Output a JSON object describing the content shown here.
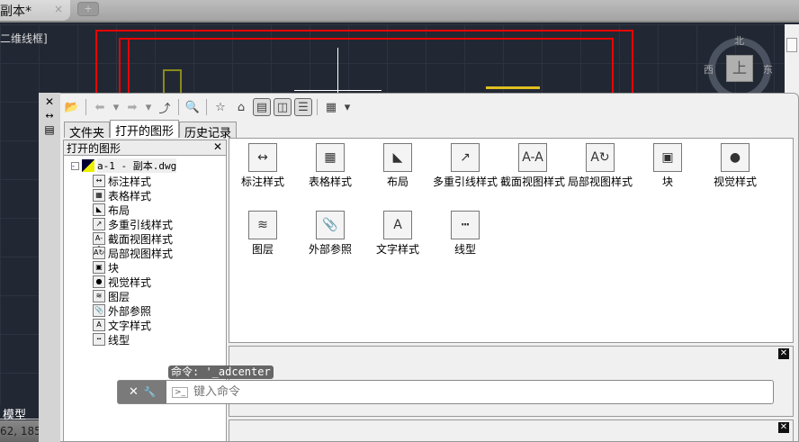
{
  "tabbar": {
    "doc_tab": "副本*",
    "close": "×",
    "new_tab": "+"
  },
  "viewport": {
    "view_label": "二维线框]",
    "compass": {
      "north": "北",
      "west": "西",
      "east": "东",
      "cube": "上"
    }
  },
  "palette": {
    "side": {
      "close": "✕",
      "autohide": "↔",
      "props": "▤"
    },
    "tabs": [
      "文件夹",
      "打开的图形",
      "历史记录"
    ],
    "tree": {
      "header": "打开的图形",
      "close": "✕",
      "root": "a-1 - 副本.dwg",
      "items": [
        "标注样式",
        "表格样式",
        "布局",
        "多重引线样式",
        "截面视图样式",
        "局部视图样式",
        "块",
        "视觉样式",
        "图层",
        "外部参照",
        "文字样式",
        "线型"
      ]
    },
    "content_items": [
      {
        "label": "标注样式",
        "icon": "dim-style-icon",
        "glyph": "↔"
      },
      {
        "label": "表格样式",
        "icon": "table-style-icon",
        "glyph": "▦"
      },
      {
        "label": "布局",
        "icon": "layout-icon",
        "glyph": "◣"
      },
      {
        "label": "多重引线样式",
        "icon": "mleader-icon",
        "glyph": "↗"
      },
      {
        "label": "截面视图样式",
        "icon": "section-view-icon",
        "glyph": "A-A"
      },
      {
        "label": "局部视图样式",
        "icon": "detail-view-icon",
        "glyph": "A↻"
      },
      {
        "label": "块",
        "icon": "block-icon",
        "glyph": "▣"
      },
      {
        "label": "视觉样式",
        "icon": "visual-style-icon",
        "glyph": "●"
      },
      {
        "label": "图层",
        "icon": "layer-icon",
        "glyph": "≋"
      },
      {
        "label": "外部参照",
        "icon": "xref-icon",
        "glyph": "📎"
      },
      {
        "label": "文字样式",
        "icon": "text-style-icon",
        "glyph": "A"
      },
      {
        "label": "线型",
        "icon": "linetype-icon",
        "glyph": "┅"
      }
    ],
    "panel_close": "✕"
  },
  "command": {
    "tooltip": "命令: '_adcenter",
    "placeholder": "键入命令",
    "close": "✕",
    "settings": "🔧",
    "prompt": ">_"
  },
  "status": {
    "model_tab": "模型",
    "coords": "62, 185"
  }
}
